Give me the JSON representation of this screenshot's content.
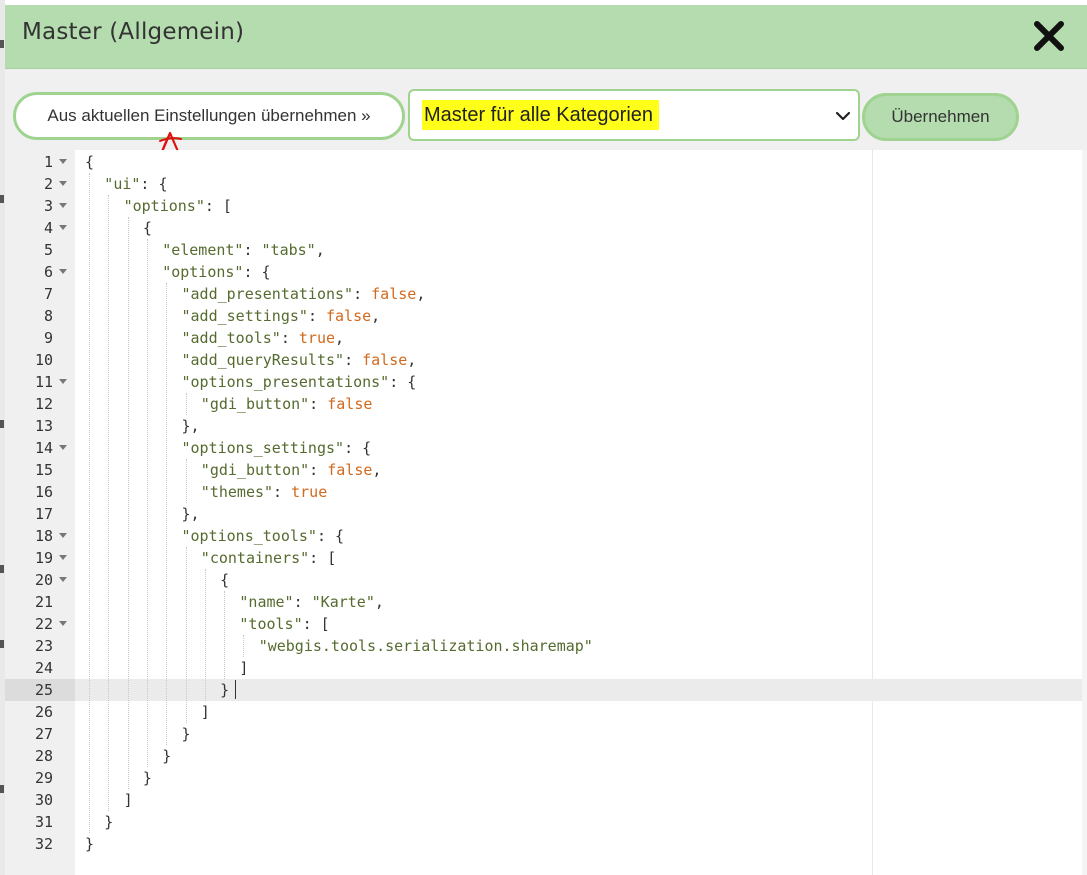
{
  "dialog": {
    "title": "Master (Allgemein)",
    "close_icon": "close-x-icon"
  },
  "toolbar": {
    "take_button_label": "Aus aktuellen Einstellungen übernehmen »",
    "select_value": "Master für alle Kategorien",
    "select_icon": "chevron-down-icon",
    "apply_button_label": "Übernehmen"
  },
  "editor": {
    "active_line": 25,
    "lines": [
      {
        "n": "1",
        "fold": true,
        "indent": 0,
        "tokens": [
          {
            "t": "p",
            "v": "{"
          }
        ]
      },
      {
        "n": "2",
        "fold": true,
        "indent": 1,
        "tokens": [
          {
            "t": "k",
            "v": "\"ui\""
          },
          {
            "t": "p",
            "v": ": {"
          }
        ]
      },
      {
        "n": "3",
        "fold": true,
        "indent": 2,
        "tokens": [
          {
            "t": "k",
            "v": "\"options\""
          },
          {
            "t": "p",
            "v": ": ["
          }
        ]
      },
      {
        "n": "4",
        "fold": true,
        "indent": 3,
        "tokens": [
          {
            "t": "p",
            "v": "{"
          }
        ]
      },
      {
        "n": "5",
        "fold": false,
        "indent": 4,
        "tokens": [
          {
            "t": "k",
            "v": "\"element\""
          },
          {
            "t": "p",
            "v": ": "
          },
          {
            "t": "s",
            "v": "\"tabs\""
          },
          {
            "t": "p",
            "v": ","
          }
        ]
      },
      {
        "n": "6",
        "fold": true,
        "indent": 4,
        "tokens": [
          {
            "t": "k",
            "v": "\"options\""
          },
          {
            "t": "p",
            "v": ": {"
          }
        ]
      },
      {
        "n": "7",
        "fold": false,
        "indent": 5,
        "tokens": [
          {
            "t": "k",
            "v": "\"add_presentations\""
          },
          {
            "t": "p",
            "v": ": "
          },
          {
            "t": "b",
            "v": "false"
          },
          {
            "t": "p",
            "v": ","
          }
        ]
      },
      {
        "n": "8",
        "fold": false,
        "indent": 5,
        "tokens": [
          {
            "t": "k",
            "v": "\"add_settings\""
          },
          {
            "t": "p",
            "v": ": "
          },
          {
            "t": "b",
            "v": "false"
          },
          {
            "t": "p",
            "v": ","
          }
        ]
      },
      {
        "n": "9",
        "fold": false,
        "indent": 5,
        "tokens": [
          {
            "t": "k",
            "v": "\"add_tools\""
          },
          {
            "t": "p",
            "v": ": "
          },
          {
            "t": "b",
            "v": "true"
          },
          {
            "t": "p",
            "v": ","
          }
        ]
      },
      {
        "n": "10",
        "fold": false,
        "indent": 5,
        "tokens": [
          {
            "t": "k",
            "v": "\"add_queryResults\""
          },
          {
            "t": "p",
            "v": ": "
          },
          {
            "t": "b",
            "v": "false"
          },
          {
            "t": "p",
            "v": ","
          }
        ]
      },
      {
        "n": "11",
        "fold": true,
        "indent": 5,
        "tokens": [
          {
            "t": "k",
            "v": "\"options_presentations\""
          },
          {
            "t": "p",
            "v": ": {"
          }
        ]
      },
      {
        "n": "12",
        "fold": false,
        "indent": 6,
        "tokens": [
          {
            "t": "k",
            "v": "\"gdi_button\""
          },
          {
            "t": "p",
            "v": ": "
          },
          {
            "t": "b",
            "v": "false"
          }
        ]
      },
      {
        "n": "13",
        "fold": false,
        "indent": 5,
        "tokens": [
          {
            "t": "p",
            "v": "},"
          }
        ]
      },
      {
        "n": "14",
        "fold": true,
        "indent": 5,
        "tokens": [
          {
            "t": "k",
            "v": "\"options_settings\""
          },
          {
            "t": "p",
            "v": ": {"
          }
        ]
      },
      {
        "n": "15",
        "fold": false,
        "indent": 6,
        "tokens": [
          {
            "t": "k",
            "v": "\"gdi_button\""
          },
          {
            "t": "p",
            "v": ": "
          },
          {
            "t": "b",
            "v": "false"
          },
          {
            "t": "p",
            "v": ","
          }
        ]
      },
      {
        "n": "16",
        "fold": false,
        "indent": 6,
        "tokens": [
          {
            "t": "k",
            "v": "\"themes\""
          },
          {
            "t": "p",
            "v": ": "
          },
          {
            "t": "b",
            "v": "true"
          }
        ]
      },
      {
        "n": "17",
        "fold": false,
        "indent": 5,
        "tokens": [
          {
            "t": "p",
            "v": "},"
          }
        ]
      },
      {
        "n": "18",
        "fold": true,
        "indent": 5,
        "tokens": [
          {
            "t": "k",
            "v": "\"options_tools\""
          },
          {
            "t": "p",
            "v": ": {"
          }
        ]
      },
      {
        "n": "19",
        "fold": true,
        "indent": 6,
        "tokens": [
          {
            "t": "k",
            "v": "\"containers\""
          },
          {
            "t": "p",
            "v": ": ["
          }
        ]
      },
      {
        "n": "20",
        "fold": true,
        "indent": 7,
        "tokens": [
          {
            "t": "p",
            "v": "{"
          }
        ]
      },
      {
        "n": "21",
        "fold": false,
        "indent": 8,
        "tokens": [
          {
            "t": "k",
            "v": "\"name\""
          },
          {
            "t": "p",
            "v": ": "
          },
          {
            "t": "s",
            "v": "\"Karte\""
          },
          {
            "t": "p",
            "v": ","
          }
        ]
      },
      {
        "n": "22",
        "fold": true,
        "indent": 8,
        "tokens": [
          {
            "t": "k",
            "v": "\"tools\""
          },
          {
            "t": "p",
            "v": ": ["
          }
        ]
      },
      {
        "n": "23",
        "fold": false,
        "indent": 9,
        "tokens": [
          {
            "t": "s",
            "v": "\"webgis.tools.serialization.sharemap\""
          }
        ]
      },
      {
        "n": "24",
        "fold": false,
        "indent": 8,
        "tokens": [
          {
            "t": "p",
            "v": "]"
          }
        ]
      },
      {
        "n": "25",
        "fold": false,
        "indent": 7,
        "tokens": [
          {
            "t": "p",
            "v": "}"
          }
        ]
      },
      {
        "n": "26",
        "fold": false,
        "indent": 6,
        "tokens": [
          {
            "t": "p",
            "v": "]"
          }
        ]
      },
      {
        "n": "27",
        "fold": false,
        "indent": 5,
        "tokens": [
          {
            "t": "p",
            "v": "}"
          }
        ]
      },
      {
        "n": "28",
        "fold": false,
        "indent": 4,
        "tokens": [
          {
            "t": "p",
            "v": "}"
          }
        ]
      },
      {
        "n": "29",
        "fold": false,
        "indent": 3,
        "tokens": [
          {
            "t": "p",
            "v": "}"
          }
        ]
      },
      {
        "n": "30",
        "fold": false,
        "indent": 2,
        "tokens": [
          {
            "t": "p",
            "v": "]"
          }
        ]
      },
      {
        "n": "31",
        "fold": false,
        "indent": 1,
        "tokens": [
          {
            "t": "p",
            "v": "}"
          }
        ]
      },
      {
        "n": "32",
        "fold": false,
        "indent": 0,
        "tokens": [
          {
            "t": "p",
            "v": "}"
          }
        ]
      }
    ]
  }
}
